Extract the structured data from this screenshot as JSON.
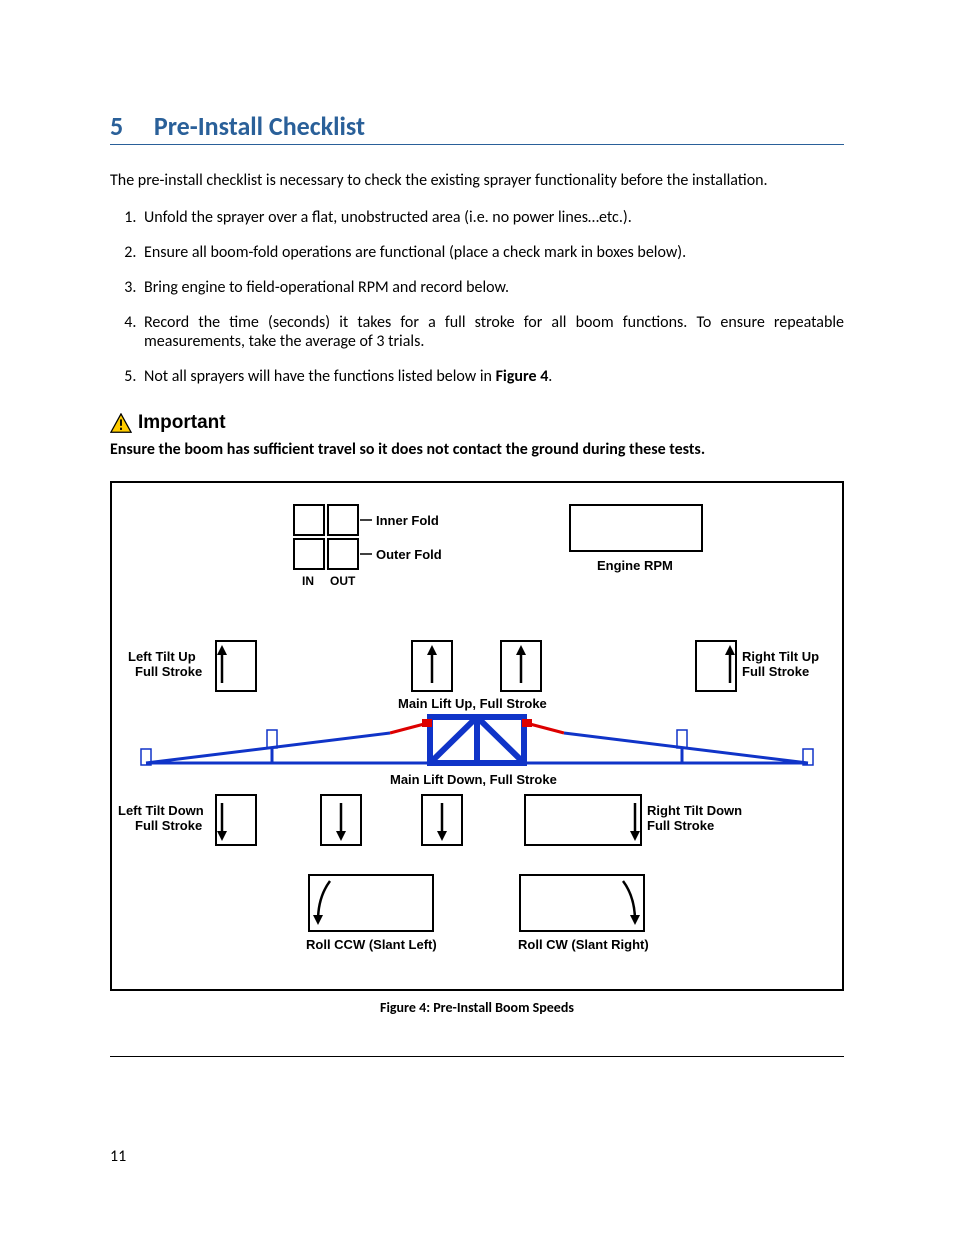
{
  "section": {
    "number": "5",
    "title": "Pre-Install Checklist"
  },
  "intro": "The pre-install checklist is necessary to check the existing sprayer functionality before the installation.",
  "items": [
    "Unfold the sprayer over a flat, unobstructed area (i.e. no power lines…etc.).",
    "Ensure all boom-fold operations are functional (place a check mark in boxes below).",
    "Bring engine to field-operational RPM and record below.",
    "Record the time (seconds) it takes for a full stroke for all boom functions.  To ensure repeatable measurements, take the average of 3 trials.",
    "Not all sprayers will have the functions listed below in "
  ],
  "item5_bold": "Figure 4",
  "item5_tail": ".",
  "important": {
    "label": "Important",
    "text": "Ensure the boom has sufficient travel so it does not contact the ground during these tests."
  },
  "figure": {
    "caption": "Figure 4: Pre-Install Boom Speeds",
    "labels": {
      "inner_fold": "Inner Fold",
      "outer_fold": "Outer Fold",
      "in": "IN",
      "out": "OUT",
      "engine_rpm": "Engine RPM",
      "left_tilt_up": "Left Tilt Up\nFull Stroke",
      "right_tilt_up": "Right Tilt Up\nFull Stroke",
      "main_up": "Main Lift Up, Full Stroke",
      "main_down": "Main Lift Down, Full Stroke",
      "left_tilt_down": "Left Tilt Down\nFull Stroke",
      "right_tilt_down": "Right Tilt  Down\nFull Stroke",
      "roll_ccw": "Roll CCW (Slant Left)",
      "roll_cw": "Roll CW (Slant Right)"
    }
  },
  "page_number": "11"
}
